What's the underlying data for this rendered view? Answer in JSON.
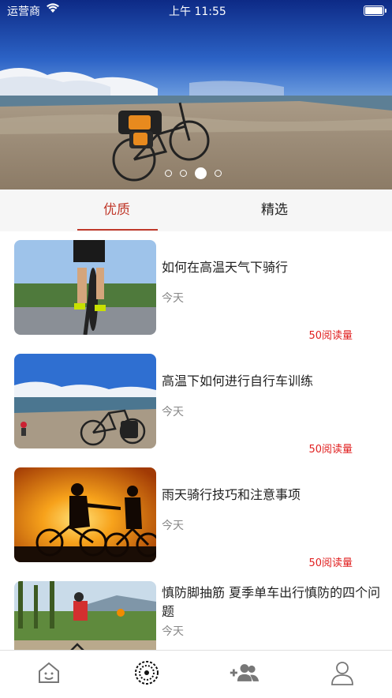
{
  "status_bar": {
    "carrier": "运营商",
    "time": "上午 11:55"
  },
  "banner": {
    "page_count": 4,
    "active_index": 2
  },
  "tabs": [
    {
      "label": "优质",
      "active": true
    },
    {
      "label": "精选",
      "active": false
    }
  ],
  "articles": [
    {
      "title": "如何在高温天气下骑行",
      "date": "今天",
      "reads": "50阅读量"
    },
    {
      "title": "高温下如何进行自行车训练",
      "date": "今天",
      "reads": "50阅读量"
    },
    {
      "title": "雨天骑行技巧和注意事项",
      "date": "今天",
      "reads": "50阅读量"
    },
    {
      "title": "慎防脚抽筋 夏季单车出行慎防的四个问题",
      "date": "今天",
      "reads": ""
    }
  ],
  "nav": [
    {
      "icon": "home-face-icon",
      "active": false
    },
    {
      "icon": "discover-circle-icon",
      "active": true
    },
    {
      "icon": "add-friend-icon",
      "active": false
    },
    {
      "icon": "profile-icon",
      "active": false
    }
  ],
  "colors": {
    "accent": "#c0392b",
    "reads": "#e02020"
  }
}
